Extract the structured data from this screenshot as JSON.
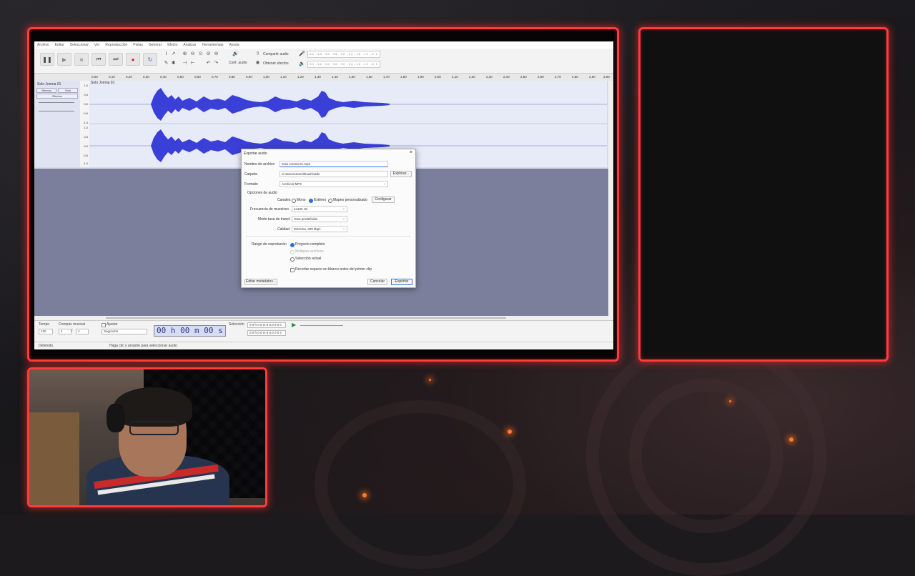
{
  "app": {
    "menu": [
      "Archivo",
      "Editar",
      "Seleccionar",
      "Ver",
      "Reproducción",
      "Pistas",
      "Generar",
      "Efecto",
      "Analizar",
      "Herramientas",
      "Ayuda"
    ],
    "toolbar": {
      "share_audio": "Compartir audio",
      "get_effects": "Obtener efectos",
      "audio_setup": "Conf. audio",
      "meter_scale": "-54 -48 -42 -36 -30 -24 -18 -12 -6 0"
    },
    "ruler_ticks": [
      "0,00",
      "0,10",
      "0,20",
      "0,30",
      "0,40",
      "0,50",
      "0,60",
      "0,70",
      "0,80",
      "0,90",
      "1,00",
      "1,10",
      "1,20",
      "1,30",
      "1,40",
      "1,50",
      "1,60",
      "1,70",
      "1,80",
      "1,90",
      "2,00",
      "2,10",
      "2,20",
      "2,30",
      "2,40",
      "2,50",
      "2,60",
      "2,70",
      "2,80",
      "2,90",
      "3,00"
    ],
    "track": {
      "name": "Solo Jonma 01",
      "clip_name": "Solo Jonma 01",
      "mute": "Silencio",
      "solo": "Solo",
      "effects": "Efectos",
      "scale_top": [
        "1,0",
        "0,5",
        "0,0",
        "-0,5",
        "-1,0"
      ],
      "scale_bottom": [
        "1,0",
        "0,5",
        "0,0",
        "-0,5",
        "-1,0"
      ]
    },
    "bottom": {
      "tempo_label": "Tempo",
      "tempo_value": "120",
      "time_signature_label": "Compás musical",
      "ts_num": "4",
      "ts_den": "4",
      "snap_label": "Ajustar",
      "snap_value": "Segundos",
      "time_display": "00 h 00 m 00 s",
      "selection_label": "Selección",
      "sel_start": "0 0 h 0 0 m 0 0,0 0 0 s",
      "sel_end": "0 0 h 0 0 m 0 0,0 0 0 s"
    },
    "status": {
      "left": "Detenido.",
      "middle": "Haga clic y arrastre para seleccionar audio"
    }
  },
  "dialog": {
    "title": "Exportar audio",
    "file_name_label": "Nombre de archivo",
    "file_name": "Solo Jonma 01.mp3",
    "folder_label": "Carpeta",
    "folder": "C:\\Users\\Jonm\\Downloads",
    "browse": "Explorar...",
    "format_label": "Formato",
    "format": "Archivos MP3",
    "audio_options": "Opciones de audio",
    "channels_label": "Canales",
    "mono": "Mono",
    "stereo": "Estéreo",
    "custom_mapping": "Mapeo personalizado",
    "configure": "Configurar",
    "sample_rate_label": "Frecuencia de muestreo",
    "sample_rate": "44100 Hz",
    "bitrate_mode_label": "Modo tasa de transf.",
    "bitrate_mode": "Tasa predefinida",
    "quality_label": "Calidad",
    "quality": "Extrema, 320 kbps",
    "range_label": "Rango de exportación",
    "range_project": "Proyecto completo",
    "range_multiple": "Múltiples archivos",
    "range_selection": "Selección actual",
    "trim_label": "Recortar espacio en blanco antes del primer clip",
    "edit_metadata": "Editar metadatos...",
    "cancel": "Cancelar",
    "export": "Exportar"
  }
}
